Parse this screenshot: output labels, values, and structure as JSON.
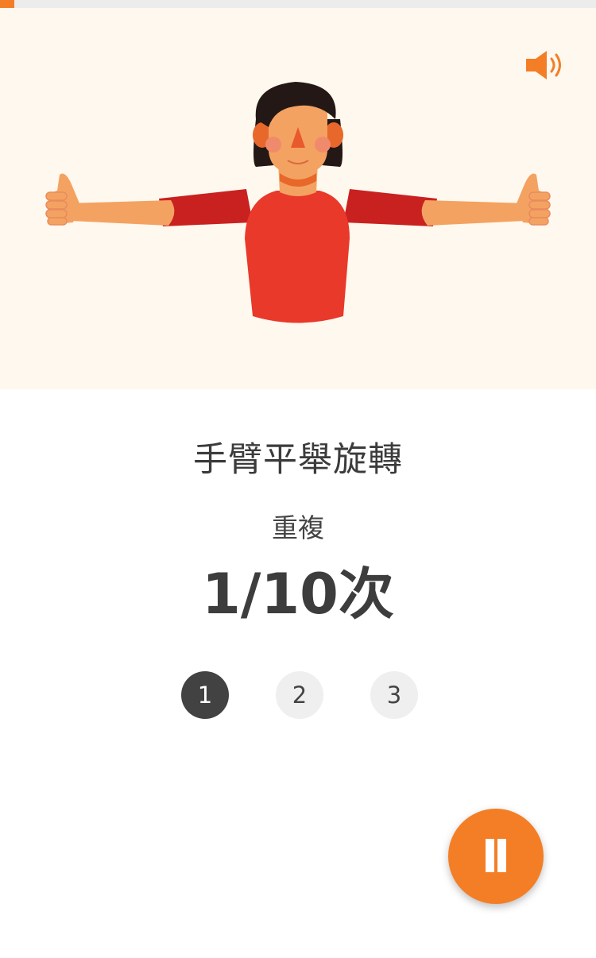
{
  "progress": {
    "fraction": 0.024
  },
  "illustration": {
    "icon": "person-arms-extended-thumbs-up"
  },
  "sound_button": {
    "icon": "speaker-volume-icon"
  },
  "exercise": {
    "title": "手臂平舉旋轉",
    "repeat_label": "重複",
    "rep_count": "1/10次"
  },
  "sets": [
    {
      "label": "1",
      "active": true
    },
    {
      "label": "2",
      "active": false
    },
    {
      "label": "3",
      "active": false
    }
  ],
  "pause_button": {
    "icon": "pause-icon"
  },
  "colors": {
    "accent": "#f47e25",
    "shirt": "#e8392a",
    "sleeve": "#c9211f",
    "skin": "#f4a261",
    "background": "#fff8ee"
  }
}
